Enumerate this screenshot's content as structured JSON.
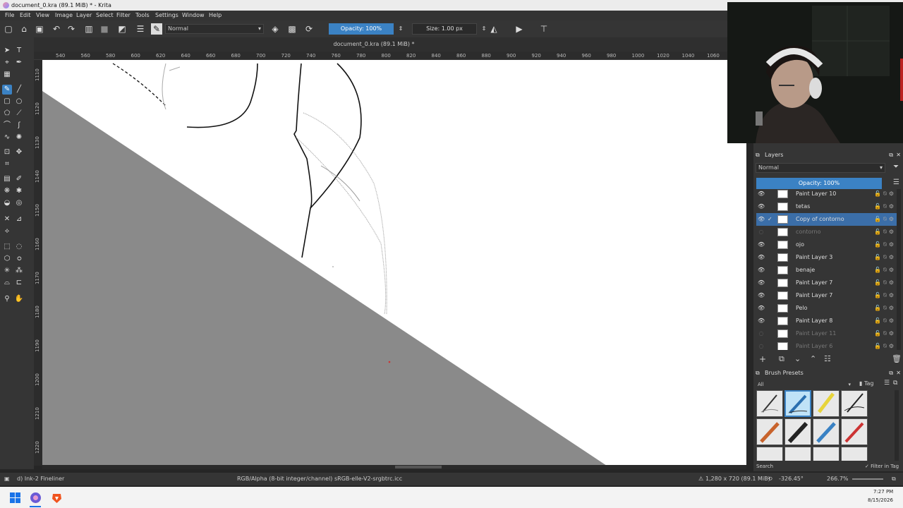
{
  "window": {
    "title": "document_0.kra (89.1 MiB) * - Krita"
  },
  "menu": [
    "File",
    "Edit",
    "View",
    "Image",
    "Layer",
    "Select",
    "Filter",
    "Tools",
    "Settings",
    "Window",
    "Help"
  ],
  "toolbar": {
    "blend_mode": "Normal",
    "opacity": "Opacity: 100%",
    "size": "Size: 1.00 px"
  },
  "document_tab": "document_0.kra (89.1 MiB) *",
  "ruler": {
    "top": [
      "540",
      "560",
      "580",
      "600",
      "620",
      "640",
      "660",
      "680",
      "700",
      "720",
      "740",
      "760",
      "780",
      "800",
      "820",
      "840",
      "860",
      "880",
      "900",
      "920",
      "940",
      "960",
      "980",
      "1000",
      "1020",
      "1040",
      "1060"
    ],
    "left": [
      "1110",
      "1120",
      "1130",
      "1140",
      "1150",
      "1160",
      "1170",
      "1180",
      "1190",
      "1200",
      "1210",
      "1220"
    ]
  },
  "layers_panel": {
    "title": "Layers",
    "blend_mode": "Normal",
    "opacity": "Opacity: 100%",
    "layers": [
      {
        "name": "Paint Layer 10",
        "visible": true,
        "selected": false,
        "dim": false
      },
      {
        "name": "tetas",
        "visible": true,
        "selected": false,
        "dim": false
      },
      {
        "name": "Copy of contorno",
        "visible": true,
        "selected": true,
        "dim": false
      },
      {
        "name": "contorno",
        "visible": false,
        "selected": false,
        "dim": true
      },
      {
        "name": "ojo",
        "visible": true,
        "selected": false,
        "dim": false
      },
      {
        "name": "Paint Layer 3",
        "visible": true,
        "selected": false,
        "dim": false
      },
      {
        "name": "benaje",
        "visible": true,
        "selected": false,
        "dim": false
      },
      {
        "name": "Paint Layer 7",
        "visible": true,
        "selected": false,
        "dim": false
      },
      {
        "name": "Paint Layer 7",
        "visible": true,
        "selected": false,
        "dim": false
      },
      {
        "name": "Pelo",
        "visible": true,
        "selected": false,
        "dim": false
      },
      {
        "name": "Paint Layer 8",
        "visible": true,
        "selected": false,
        "dim": false
      },
      {
        "name": "Paint Layer 11",
        "visible": false,
        "selected": false,
        "dim": true
      },
      {
        "name": "Paint Layer 6",
        "visible": false,
        "selected": false,
        "dim": true
      }
    ]
  },
  "brush_presets": {
    "title": "Brush Presets",
    "tag_filter": "All",
    "tag_label": "Tag",
    "search_label": "Search",
    "filter_in_tag": "Filter in Tag"
  },
  "status": {
    "brush": "d) Ink-2 Fineliner",
    "color_space": "RGB/Alpha (8-bit integer/channel)  sRGB-elle-V2-srgbtrc.icc",
    "image_size": "1,280 x 720 (89.1 MiB)",
    "rotation": "-326.45°",
    "zoom": "266.7%"
  },
  "taskbar": {
    "time": "7:27 PM",
    "date": "8/15/2026"
  }
}
